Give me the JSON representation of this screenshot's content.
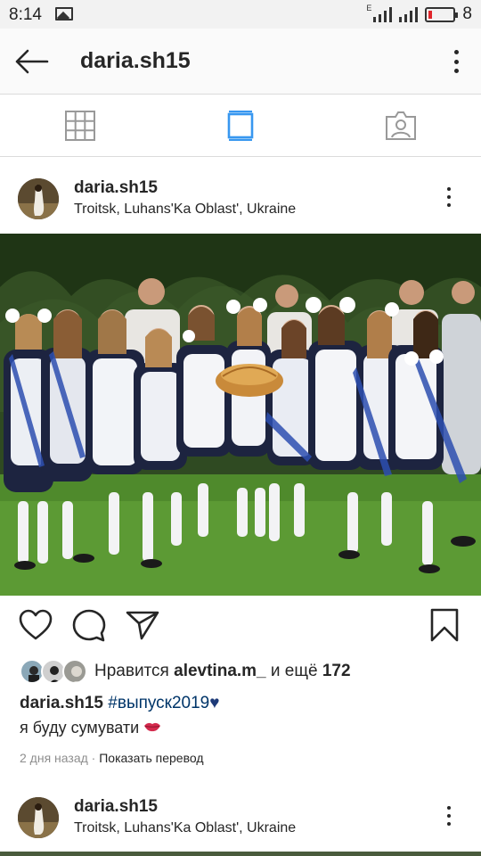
{
  "status_bar": {
    "time": "8:14",
    "battery_level": "8",
    "icons": [
      "gallery-icon",
      "signal-e-icon",
      "signal-icon",
      "battery-low-icon"
    ]
  },
  "header": {
    "title": "daria.sh15",
    "icons": [
      "arrow-back-icon",
      "more-vert-icon"
    ]
  },
  "view_tabs": [
    {
      "icon": "grid-icon",
      "active": false
    },
    {
      "icon": "feed-icon",
      "active": true
    },
    {
      "icon": "tagged-user-icon",
      "active": false
    }
  ],
  "post": {
    "username": "daria.sh15",
    "location": "Troitsk, Luhans'Ka Oblast', Ukraine",
    "photo_icon": "group-photo",
    "likes": {
      "prefix": "Нравится",
      "user": "alevtina.m_",
      "connector": "и ещё",
      "count": "172"
    },
    "caption": {
      "user": "daria.sh15",
      "hashtag": "#выпуск2019",
      "heart": "♥",
      "line2": "я буду сумувати",
      "emoji": "💋"
    },
    "time_ago": "2 дня назад",
    "separator": "·",
    "translate_label": "Показать перевод"
  },
  "post2": {
    "username": "daria.sh15",
    "location": "Troitsk, Luhans'Ka Oblast', Ukraine"
  },
  "colors": {
    "accent_blue": "#3897f0",
    "hashtag": "#003569",
    "meta_gray": "#8e8e8e",
    "divider": "#dbdbdb"
  }
}
